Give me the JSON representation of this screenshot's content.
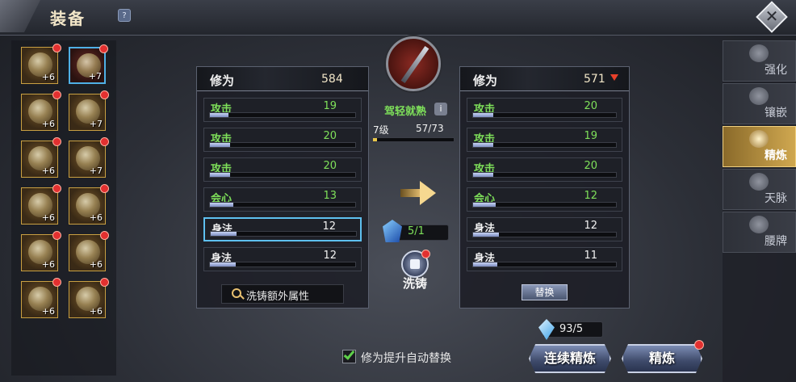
{
  "header": {
    "title": "装备",
    "help": "?",
    "close": "✕"
  },
  "equipment": [
    {
      "level": "+6",
      "selected": false,
      "alert": true
    },
    {
      "level": "+7",
      "selected": true,
      "alert": true
    },
    {
      "level": "+6",
      "selected": false,
      "alert": true
    },
    {
      "level": "+7",
      "selected": false,
      "alert": true
    },
    {
      "level": "+6",
      "selected": false,
      "alert": true
    },
    {
      "level": "+7",
      "selected": false,
      "alert": true
    },
    {
      "level": "+6",
      "selected": false,
      "alert": true
    },
    {
      "level": "+6",
      "selected": false,
      "alert": true
    },
    {
      "level": "+6",
      "selected": false,
      "alert": true
    },
    {
      "level": "+6",
      "selected": false,
      "alert": true
    },
    {
      "level": "+6",
      "selected": false,
      "alert": true
    },
    {
      "level": "+6",
      "selected": false,
      "alert": true
    }
  ],
  "current": {
    "label": "修为",
    "value": "584",
    "attributes": [
      {
        "name": "攻击",
        "value": "19",
        "color": "green",
        "fill": 0.13
      },
      {
        "name": "攻击",
        "value": "20",
        "color": "green",
        "fill": 0.14
      },
      {
        "name": "攻击",
        "value": "20",
        "color": "green",
        "fill": 0.14
      },
      {
        "name": "会心",
        "value": "13",
        "color": "green",
        "fill": 0.16
      },
      {
        "name": "身法",
        "value": "12",
        "color": "white",
        "fill": 0.18
      },
      {
        "name": "身法",
        "value": "12",
        "color": "white",
        "fill": 0.18
      }
    ],
    "extra_button": "洗铸额外属性"
  },
  "preview": {
    "label": "修为",
    "value": "571",
    "trend": "down",
    "trend_color": "#e8402a",
    "attributes": [
      {
        "name": "攻击",
        "value": "20",
        "color": "green",
        "fill": 0.14
      },
      {
        "name": "攻击",
        "value": "19",
        "color": "green",
        "fill": 0.14
      },
      {
        "name": "攻击",
        "value": "20",
        "color": "green",
        "fill": 0.14
      },
      {
        "name": "会心",
        "value": "12",
        "color": "green",
        "fill": 0.16
      },
      {
        "name": "身法",
        "value": "12",
        "color": "white",
        "fill": 0.18
      },
      {
        "name": "身法",
        "value": "11",
        "color": "white",
        "fill": 0.17
      }
    ],
    "replace_button": "替换"
  },
  "center": {
    "proficiency": "驾轻就熟",
    "info": "i",
    "level": "7级",
    "exp": "57/73",
    "exp_fraction": 0.05,
    "stone_count": "5/1",
    "wash_label": "洗铸"
  },
  "bottom": {
    "auto_replace_label": "修为提升自动替换",
    "auto_replace_checked": true,
    "diamond_count": "93/5",
    "continuous_refine": "连续精炼",
    "refine": "精炼"
  },
  "tabs": [
    {
      "label": "强化",
      "active": false
    },
    {
      "label": "镶嵌",
      "active": false
    },
    {
      "label": "精炼",
      "active": true
    },
    {
      "label": "天脉",
      "active": false
    },
    {
      "label": "腰牌",
      "active": false
    }
  ],
  "colors": {
    "green": "#7ee05a",
    "white": "#f2f2f2",
    "accent": "#5ec0f0",
    "alert": "#e23030"
  }
}
